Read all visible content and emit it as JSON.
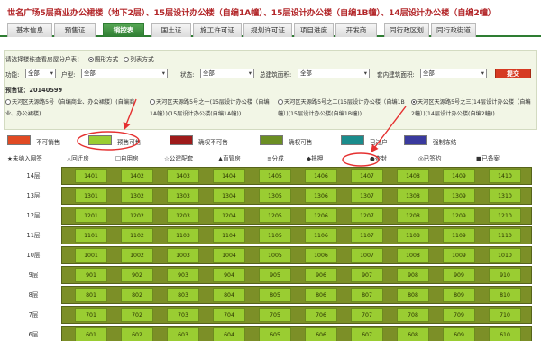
{
  "title": "世名广场5层商业办公裙楼（地下2层）、15层设计办公楼（自编1A幢）、15层设计办公楼（自编1B幢）、14层设计办公楼（自编2幢）",
  "tabs": [
    "基本信息",
    "预售证",
    "销控表",
    "国土证",
    "施工许可证",
    "规划许可证",
    "项目进度",
    "开发商",
    "同行政区划",
    "同行政街道"
  ],
  "active_tab": "销控表",
  "mode": {
    "prompt": "请选择楼栋查看房屋分户表：",
    "options": [
      "图形方式",
      "列表方式"
    ],
    "selected": "图形方式"
  },
  "filters": {
    "func_label": "功能:",
    "func_value": "全部",
    "type_label": "户型:",
    "type_value": "全部",
    "status_label": "状态:",
    "status_value": "全部",
    "total_area_label": "总建筑面积:",
    "total_area_value": "全部",
    "inner_area_label": "套内建筑面积:",
    "inner_area_value": "全部",
    "submit": "提交"
  },
  "presale": "预售证：20140599",
  "buildings": [
    "天河区天源路5号（自编商业、办公裙楼）(自编商业、办公裙楼)",
    "天河区天源路5号之一(15层设计办公楼（自编1A幢）)(15层设计办公楼(自编1A幢))",
    "天河区天源路5号之二(15层设计办公楼（自编1B幢）)(15层设计办公楼(自编1B幢))",
    "天河区天源路5号之三(14层设计办公楼（自编2幢）)(14层设计办公楼(自编2幢))"
  ],
  "legend": [
    {
      "label": "不可销售",
      "color": "#e04a23"
    },
    {
      "label": "预售可售",
      "color": "#9acd32"
    },
    {
      "label": "确权不可售",
      "color": "#9e1a1a"
    },
    {
      "label": "确权可售",
      "color": "#6b8e23"
    },
    {
      "label": "已过户",
      "color": "#1a8c8c"
    },
    {
      "label": "强制冻结",
      "color": "#3a3a9e"
    }
  ],
  "marks": [
    "★未纳入网签",
    "△回迁房",
    "☐自用房",
    "☆公建配套",
    "▲直管房",
    "≡分成",
    "◆抵押",
    "●查封",
    "◎已签约",
    "■已备案"
  ],
  "floors": [
    {
      "floor": "14层",
      "rooms": [
        "1401",
        "1402",
        "1403",
        "1404",
        "1405",
        "1406",
        "1407",
        "1408",
        "1409",
        "1410"
      ]
    },
    {
      "floor": "13层",
      "rooms": [
        "1301",
        "1302",
        "1303",
        "1304",
        "1305",
        "1306",
        "1307",
        "1308",
        "1309",
        "1310"
      ]
    },
    {
      "floor": "12层",
      "rooms": [
        "1201",
        "1202",
        "1203",
        "1204",
        "1205",
        "1206",
        "1207",
        "1208",
        "1209",
        "1210"
      ]
    },
    {
      "floor": "11层",
      "rooms": [
        "1101",
        "1102",
        "1103",
        "1104",
        "1105",
        "1106",
        "1107",
        "1108",
        "1109",
        "1110"
      ]
    },
    {
      "floor": "10层",
      "rooms": [
        "1001",
        "1002",
        "1003",
        "1004",
        "1005",
        "1006",
        "1007",
        "1008",
        "1009",
        "1010"
      ]
    },
    {
      "floor": "9层",
      "rooms": [
        "901",
        "902",
        "903",
        "904",
        "905",
        "906",
        "907",
        "908",
        "909",
        "910"
      ]
    },
    {
      "floor": "8层",
      "rooms": [
        "801",
        "802",
        "803",
        "804",
        "805",
        "806",
        "807",
        "808",
        "809",
        "810"
      ]
    },
    {
      "floor": "7层",
      "rooms": [
        "701",
        "702",
        "703",
        "704",
        "705",
        "706",
        "707",
        "708",
        "709",
        "710"
      ]
    },
    {
      "floor": "6层",
      "rooms": [
        "601",
        "602",
        "603",
        "604",
        "605",
        "606",
        "607",
        "608",
        "609",
        "610"
      ]
    }
  ],
  "colors": {
    "accent": "#2e7d32",
    "title": "#b3272a",
    "annotation": "#e53030",
    "cell": "#9acd32"
  }
}
